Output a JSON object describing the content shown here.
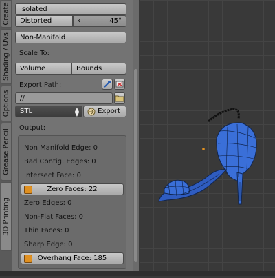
{
  "tabs": [
    "Create",
    "Shading / UVs",
    "Options",
    "Grease Pencil",
    "3D Printing"
  ],
  "checks": {
    "isolated_label": "Isolated",
    "distorted_label": "Distorted",
    "distorted_value": "45°",
    "non_manifold_label": "Non-Manifold"
  },
  "scale": {
    "label": "Scale To:",
    "volume_label": "Volume",
    "bounds_label": "Bounds"
  },
  "export": {
    "path_label": "Export Path:",
    "path_value": "//",
    "format": "STL",
    "export_label": "Export"
  },
  "output": {
    "label": "Output:",
    "non_manifold_edge": "Non Manifold Edge: 0",
    "bad_contig_edges": "Bad Contig. Edges: 0",
    "intersect_face": "Intersect Face: 0",
    "zero_faces": "Zero Faces: 22",
    "zero_edges": "Zero Edges: 0",
    "non_flat_faces": "Non-Flat Faces: 0",
    "thin_faces": "Thin Faces: 0",
    "sharp_edge": "Sharp Edge: 0",
    "overhang_face": "Overhang Face: 185"
  },
  "colors": {
    "mesh_blue": "#3a6fd8",
    "warning_orange": "#e09020"
  },
  "icons": [
    "eyedropper-icon",
    "file-browser-icon",
    "stepper-arrows-icon",
    "export-icon",
    "warning-icon"
  ]
}
